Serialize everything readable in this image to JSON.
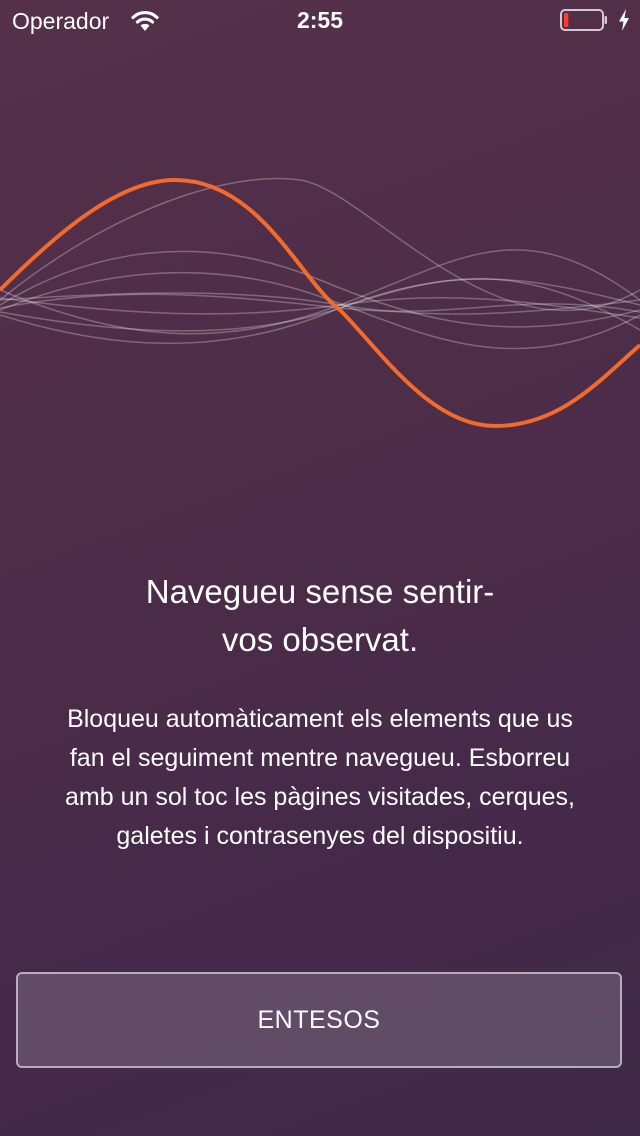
{
  "status_bar": {
    "carrier": "Operador",
    "time": "2:55",
    "icons": [
      "wifi-icon",
      "battery-icon",
      "charging-bolt-icon"
    ],
    "battery_level_fraction": 0.12,
    "battery_color": "#ff3b30"
  },
  "illustration": {
    "icon": "waveform-illustration",
    "accent_color": "#f26a2c"
  },
  "onboarding": {
    "headline_line1": "Navegueu sense sentir-",
    "headline_line2": "vos observat.",
    "body_line1": "Bloqueu automàticament els elements que us",
    "body_line2": "fan el seguiment mentre navegueu. Esborreu",
    "body_line3": "amb un sol toc les pàgines visitades, cerques,",
    "body_line4": "galetes i contrasenyes del dispositiu.",
    "button_label": "ENTESOS"
  }
}
